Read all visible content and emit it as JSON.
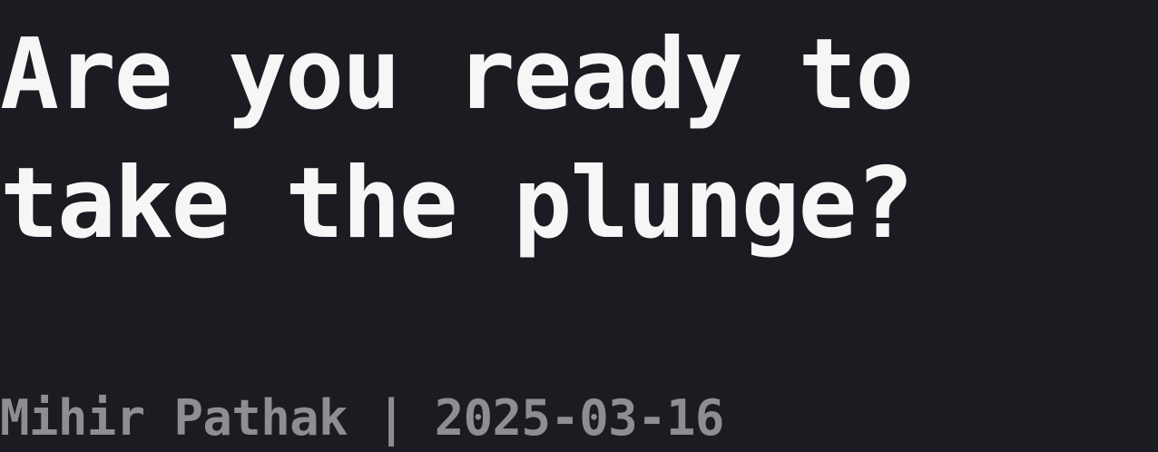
{
  "post": {
    "title_lines": [
      "Are you ready to",
      "take the plunge?"
    ],
    "author": "Mihir Pathak",
    "separator": "|",
    "date": "2025-03-16"
  },
  "colors": {
    "background": "#1b1c21",
    "title_text": "#f6f6f6",
    "byline_text": "#8d8d92"
  }
}
